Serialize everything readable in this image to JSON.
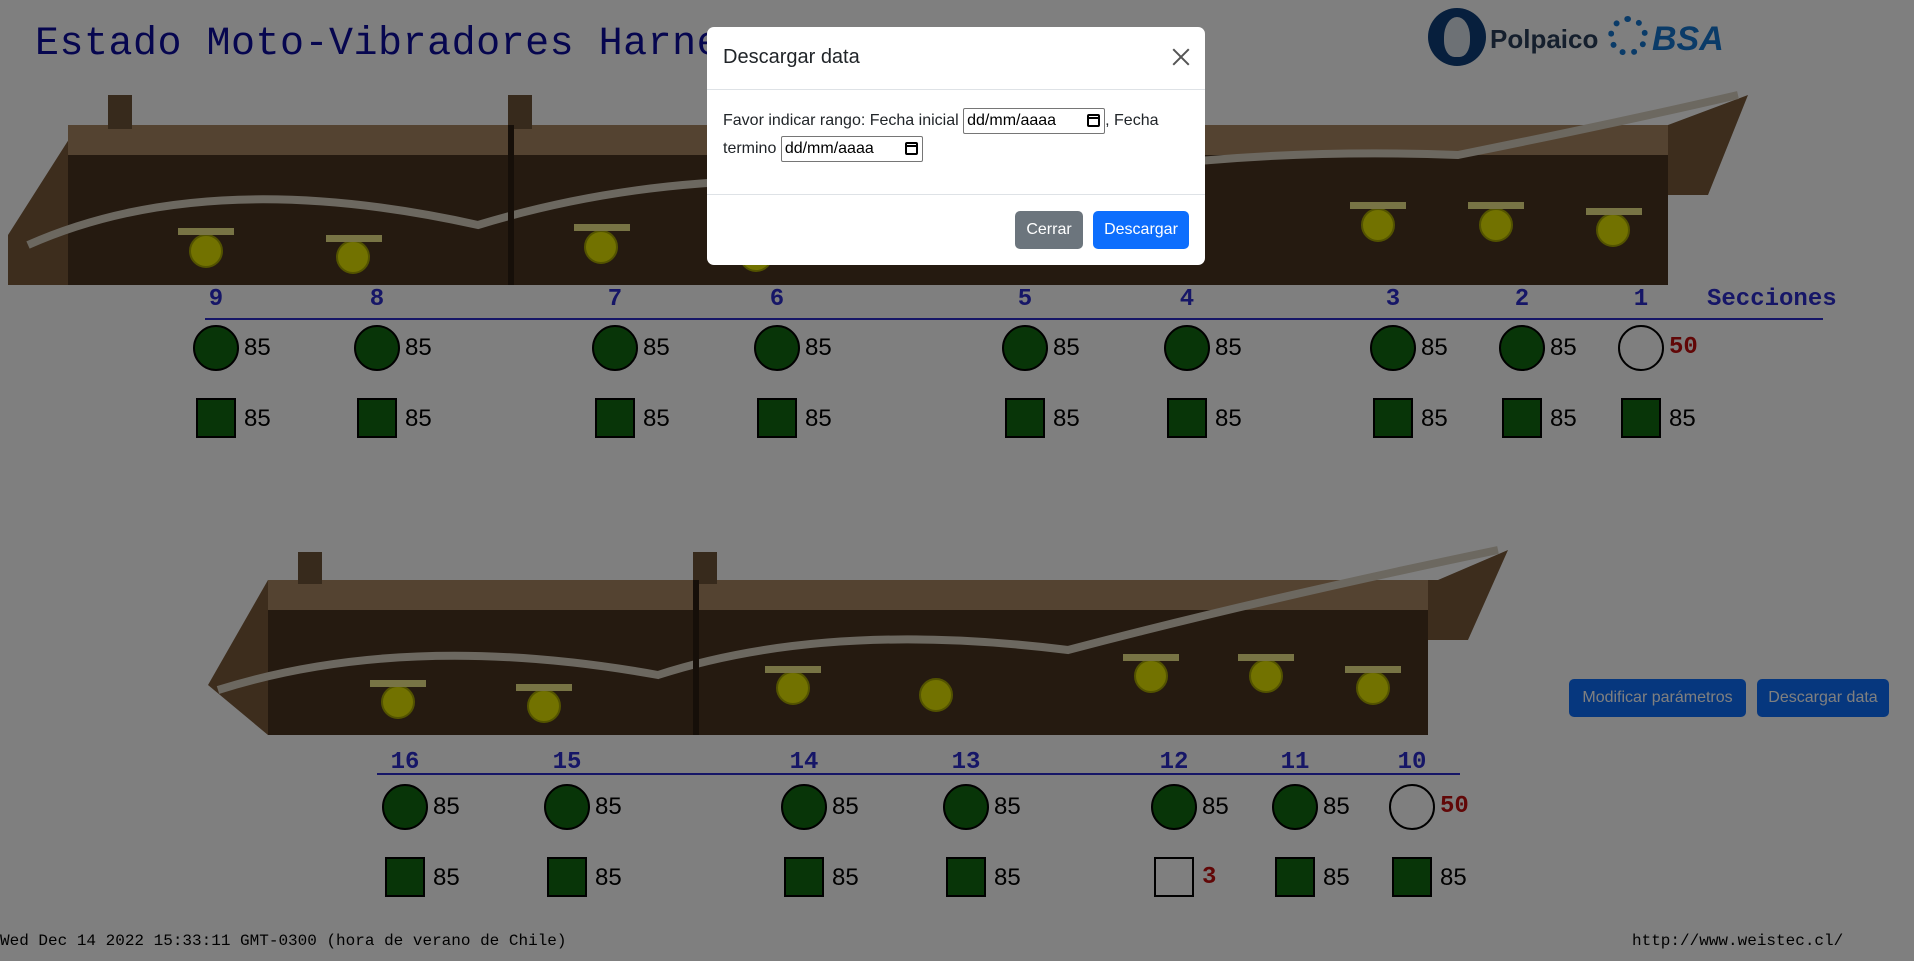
{
  "header": {
    "title": "Estado Moto-Vibradores Harnero"
  },
  "logos": {
    "polpaico": "Polpaico",
    "bsa": "BSA"
  },
  "sections_label": "Secciones",
  "colors": {
    "ok": "#116b11",
    "alarm": "#b50d0d",
    "accent": "#2c2ccf",
    "primary": "#0d6efd"
  },
  "row1": [
    {
      "section": "9",
      "circle_value": "85",
      "circle_status": "ok",
      "square_value": "85",
      "square_status": "ok"
    },
    {
      "section": "8",
      "circle_value": "85",
      "circle_status": "ok",
      "square_value": "85",
      "square_status": "ok"
    },
    {
      "section": "7",
      "circle_value": "85",
      "circle_status": "ok",
      "square_value": "85",
      "square_status": "ok"
    },
    {
      "section": "6",
      "circle_value": "85",
      "circle_status": "ok",
      "square_value": "85",
      "square_status": "ok"
    },
    {
      "section": "5",
      "circle_value": "85",
      "circle_status": "ok",
      "square_value": "85",
      "square_status": "ok"
    },
    {
      "section": "4",
      "circle_value": "85",
      "circle_status": "ok",
      "square_value": "85",
      "square_status": "ok"
    },
    {
      "section": "3",
      "circle_value": "85",
      "circle_status": "ok",
      "square_value": "85",
      "square_status": "ok"
    },
    {
      "section": "2",
      "circle_value": "85",
      "circle_status": "ok",
      "square_value": "85",
      "square_status": "ok"
    },
    {
      "section": "1",
      "circle_value": "50",
      "circle_status": "alarm",
      "square_value": "85",
      "square_status": "ok"
    }
  ],
  "row2": [
    {
      "section": "16",
      "circle_value": "85",
      "circle_status": "ok",
      "square_value": "85",
      "square_status": "ok"
    },
    {
      "section": "15",
      "circle_value": "85",
      "circle_status": "ok",
      "square_value": "85",
      "square_status": "ok"
    },
    {
      "section": "14",
      "circle_value": "85",
      "circle_status": "ok",
      "square_value": "85",
      "square_status": "ok"
    },
    {
      "section": "13",
      "circle_value": "85",
      "circle_status": "ok",
      "square_value": "85",
      "square_status": "ok"
    },
    {
      "section": "12",
      "circle_value": "85",
      "circle_status": "ok",
      "square_value": "3",
      "square_status": "alarm"
    },
    {
      "section": "11",
      "circle_value": "85",
      "circle_status": "ok",
      "square_value": "85",
      "square_status": "ok"
    },
    {
      "section": "10",
      "circle_value": "50",
      "circle_status": "alarm",
      "square_value": "85",
      "square_status": "ok"
    }
  ],
  "actions": {
    "modify_label": "Modificar parámetros",
    "download_label": "Descargar data"
  },
  "footer": {
    "datetime": "Wed Dec 14 2022 15:33:11 GMT-0300 (hora de verano de Chile)",
    "link": "http://www.weistec.cl/"
  },
  "modal": {
    "title": "Descargar data",
    "text_before": "Favor indicar rango: Fecha inicial",
    "text_middle": ", Fecha termino",
    "start_placeholder": "dd/mm/aaaa",
    "end_placeholder": "dd/mm/aaaa",
    "close_label": "Cerrar",
    "download_label": "Descargar"
  }
}
